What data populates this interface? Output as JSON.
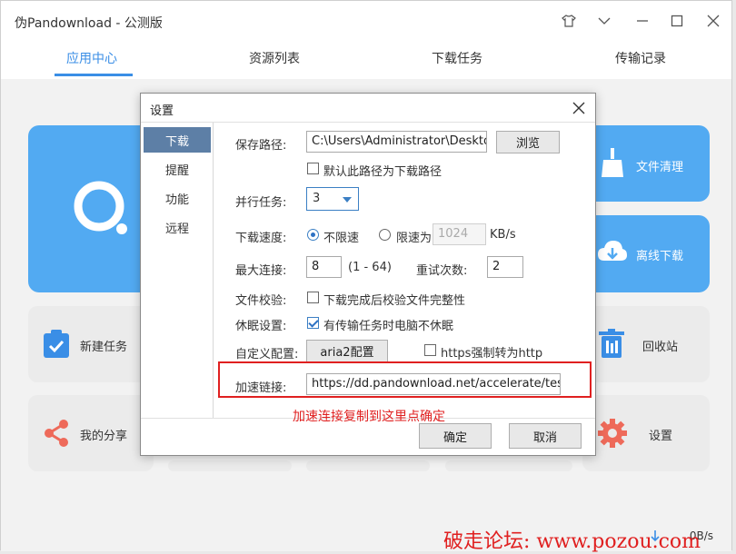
{
  "window": {
    "title": "伪Pandownload - 公测版",
    "controls": [
      "skin-icon",
      "minimize-chevron-icon",
      "minimize-icon",
      "maximize-icon",
      "close-icon"
    ]
  },
  "tabs": [
    {
      "label": "应用中心",
      "active": true
    },
    {
      "label": "资源列表",
      "active": false
    },
    {
      "label": "下载任务",
      "active": false
    },
    {
      "label": "传输记录",
      "active": false
    }
  ],
  "cards": {
    "file_clean": "文件清理",
    "offline_download": "离线下载",
    "new_task": "新建任务",
    "recycle_bin": "回收站",
    "my_share": "我的分享",
    "settings": "设置"
  },
  "status": {
    "speed": "0B/s"
  },
  "dialog": {
    "title": "设置",
    "sidebar": [
      {
        "label": "下载",
        "active": true
      },
      {
        "label": "提醒",
        "active": false
      },
      {
        "label": "功能",
        "active": false
      },
      {
        "label": "远程",
        "active": false
      }
    ],
    "save_path": {
      "label": "保存路径:",
      "value": "C:\\Users\\Administrator\\Desktop",
      "browse": "浏览"
    },
    "default_path": {
      "label": "默认此路径为下载路径",
      "checked": false
    },
    "parallel": {
      "label": "并行任务:",
      "value": "3"
    },
    "speed": {
      "label": "下载速度:",
      "unlimited": "不限速",
      "limited": "限速为",
      "limit_value": "1024",
      "unit": "KB/s",
      "selected": "unlimited"
    },
    "max_conn": {
      "label": "最大连接:",
      "value": "8",
      "range": "(1 - 64)"
    },
    "retry": {
      "label": "重试次数:",
      "value": "2"
    },
    "verify": {
      "label": "文件校验:",
      "option": "下载完成后校验文件完整性",
      "checked": false
    },
    "sleep": {
      "label": "休眠设置:",
      "option": "有传输任务时电脑不休眠",
      "checked": true
    },
    "custom": {
      "label": "自定义配置:",
      "button": "aria2配置",
      "https_option": "https强制转为http",
      "https_checked": false
    },
    "accel": {
      "label": "加速链接:",
      "value": "https://dd.pandownload.net/accelerate/test"
    },
    "ok": "确定",
    "cancel": "取消"
  },
  "annotation": "加速连接复制到这里点确定",
  "watermark": "破走论坛: www.pozou.com",
  "colors": {
    "accent": "#3a8ee6",
    "card_blue": "#52aaf2",
    "highlight_red": "#e02020",
    "sidebar_active": "#5d7fa6"
  }
}
